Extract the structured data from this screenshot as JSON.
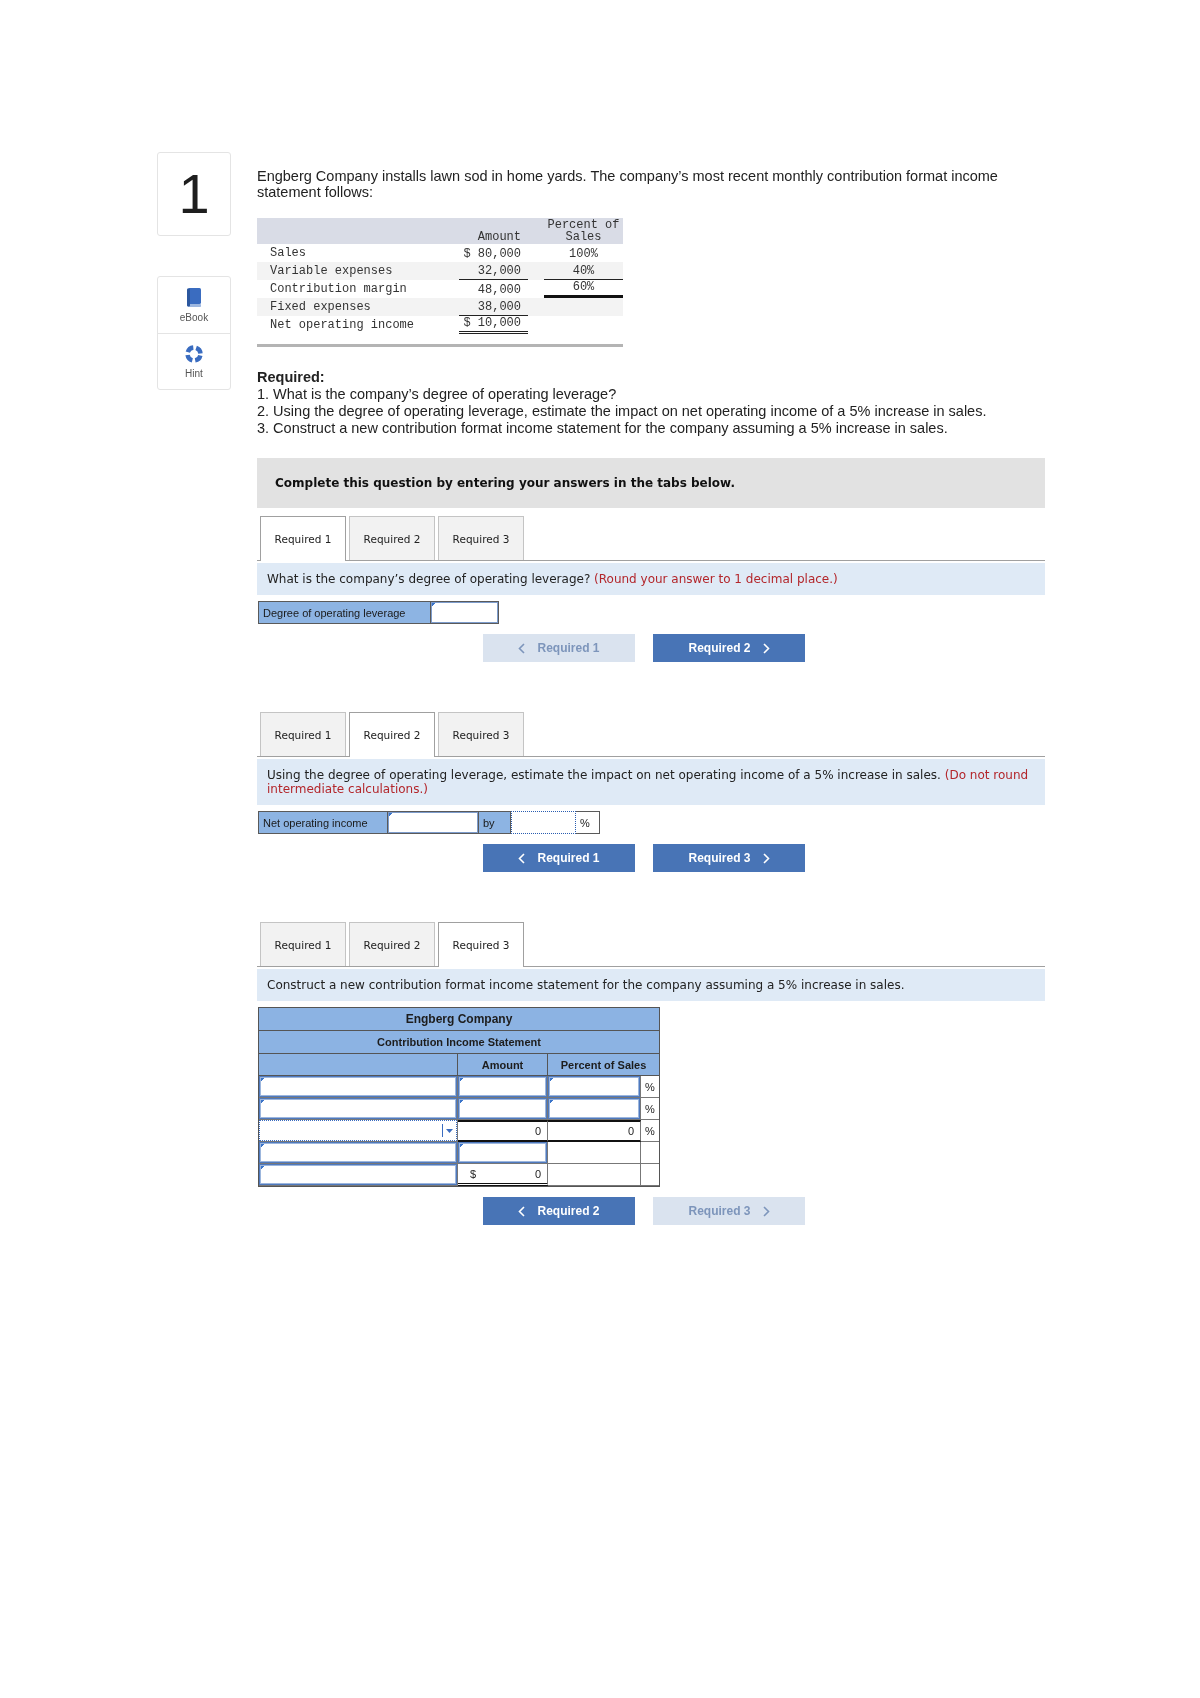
{
  "question": {
    "number": "1"
  },
  "sidebar": {
    "items": [
      {
        "label": "eBook",
        "kind": "book"
      },
      {
        "label": "Hint",
        "kind": "hint"
      }
    ]
  },
  "intro": "Engberg Company installs lawn sod in home yards. The company’s most recent monthly contribution format income statement follows:",
  "income_statement": {
    "columns": [
      "Amount",
      "Percent of Sales"
    ],
    "rows": [
      {
        "label": "Sales",
        "amount": "$ 80,000",
        "percent": "100%",
        "kind": "plain"
      },
      {
        "label": "Variable expenses",
        "amount": "32,000",
        "percent": "40%",
        "kind": "ruled"
      },
      {
        "label": "Contribution margin",
        "amount": "48,000",
        "percent": "60%",
        "kind": "subtotal"
      },
      {
        "label": "Fixed expenses",
        "amount": "38,000",
        "kind": "ruled"
      },
      {
        "label": "Net operating income",
        "amount": "$ 10,000",
        "kind": "total"
      }
    ]
  },
  "required": {
    "heading": "Required:",
    "items": [
      "1. What is the company’s degree of operating leverage?",
      "2. Using the degree of operating leverage, estimate the impact on net operating income of a 5% increase in sales.",
      "3. Construct a new contribution format income statement for the company assuming a 5% increase in sales."
    ]
  },
  "instruction": "Complete this question by entering your answers in the tabs below.",
  "parts": [
    {
      "tabs": [
        {
          "label": "Required 1",
          "selected": true
        },
        {
          "label": "Required 2",
          "selected": false
        },
        {
          "label": "Required 3",
          "selected": false
        }
      ],
      "prompt": "What is the company’s degree of operating leverage?",
      "note": "(Round your answer to 1 decimal place.)",
      "answer": {
        "kind": "field",
        "label": "Degree of operating leverage",
        "fields": [
          {
            "focused": false
          }
        ]
      },
      "buttons": [
        {
          "label": "Required 1",
          "kind": "prev",
          "disabled": true
        },
        {
          "label": "Required 2",
          "kind": "next",
          "disabled": false
        }
      ]
    },
    {
      "tabs": [
        {
          "label": "Required 1",
          "selected": false
        },
        {
          "label": "Required 2",
          "selected": true
        },
        {
          "label": "Required 3",
          "selected": false
        }
      ],
      "prompt": "Using the degree of operating leverage, estimate the impact on net operating income of a 5% increase in sales.",
      "note": "(Do not round intermediate calculations.)",
      "answer": {
        "kind": "change",
        "label": "Net operating income",
        "connector": "by",
        "unit": "%",
        "fields": [
          {
            "focused": false
          },
          {
            "focused": true
          }
        ]
      },
      "buttons": [
        {
          "label": "Required 1",
          "kind": "prev",
          "disabled": false
        },
        {
          "label": "Required 3",
          "kind": "next",
          "disabled": false
        }
      ]
    },
    {
      "tabs": [
        {
          "label": "Required 1",
          "selected": false
        },
        {
          "label": "Required 2",
          "selected": false
        },
        {
          "label": "Required 3",
          "selected": true
        }
      ],
      "prompt": "Construct a new contribution format income statement for the company assuming a 5% increase in sales.",
      "answer": {
        "kind": "statement",
        "title": "Engberg Company",
        "subtitle": "Contribution Income Statement",
        "columns": [
          "Amount",
          "Percent of Sales"
        ],
        "rows": [
          {
            "label": {
              "kind": "input"
            },
            "amount": {
              "kind": "input"
            },
            "percent": {
              "kind": "input"
            },
            "unit": "%"
          },
          {
            "label": {
              "kind": "input"
            },
            "amount": {
              "kind": "input"
            },
            "percent": {
              "kind": "input"
            },
            "unit": "%"
          },
          {
            "label": {
              "kind": "select"
            },
            "amount": {
              "kind": "subtotal",
              "value": "0"
            },
            "percent": {
              "kind": "subtotal",
              "value": "0"
            },
            "unit": "%"
          },
          {
            "label": {
              "kind": "input"
            },
            "amount": {
              "kind": "input"
            },
            "percent": {
              "kind": "blank"
            }
          },
          {
            "label": {
              "kind": "input"
            },
            "amount": {
              "kind": "total",
              "currency": "$",
              "value": "0"
            },
            "percent": {
              "kind": "blank"
            }
          }
        ]
      },
      "buttons": [
        {
          "label": "Required 2",
          "kind": "prev",
          "disabled": false
        },
        {
          "label": "Required 3",
          "kind": "next",
          "disabled": true
        }
      ]
    }
  ]
}
